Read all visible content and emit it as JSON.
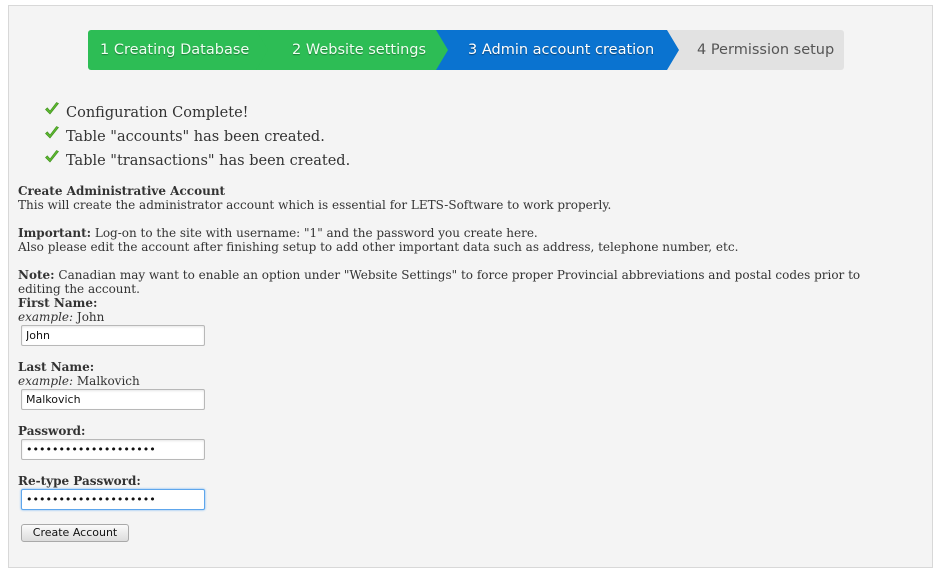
{
  "wizard": {
    "steps": [
      {
        "label": "1 Creating Database",
        "state": "done"
      },
      {
        "label": "2 Website settings",
        "state": "done"
      },
      {
        "label": "3 Admin account creation",
        "state": "active"
      },
      {
        "label": "4 Permission setup",
        "state": "todo"
      }
    ]
  },
  "checklist": [
    {
      "icon": "check-icon",
      "text": "Configuration Complete!"
    },
    {
      "icon": "check-icon",
      "text": "Table \"accounts\" has been created."
    },
    {
      "icon": "check-icon",
      "text": "Table \"transactions\" has been created."
    }
  ],
  "section": {
    "title": "Create Administrative Account",
    "intro": "This will create the administrator account which is essential for LETS-Software to work properly.",
    "important_label": "Important:",
    "important_text": " Log-on to the site with username: \"1\" and the password you create here.",
    "important_text2": "Also please edit the account after finishing setup to add other important data such as address, telephone number, etc.",
    "note_label": "Note:",
    "note_text": " Canadian may want to enable an option under \"Website Settings\" to force proper Provincial abbreviations and postal codes prior to editing the account."
  },
  "form": {
    "first_name": {
      "label": "First Name:",
      "example_label": "example:",
      "example_value": " John",
      "value": "John"
    },
    "last_name": {
      "label": "Last Name:",
      "example_label": "example:",
      "example_value": " Malkovich",
      "value": "Malkovich"
    },
    "password": {
      "label": "Password:",
      "value": "••••••••••••••••••••"
    },
    "retype_password": {
      "label": "Re-type Password:",
      "value": "••••••••••••••••••••"
    },
    "submit_label": "Create Account"
  },
  "colors": {
    "step_done": "#2dbd55",
    "step_active": "#0a73d0",
    "step_todo": "#e2e2e2",
    "check": "#5cb82f"
  }
}
